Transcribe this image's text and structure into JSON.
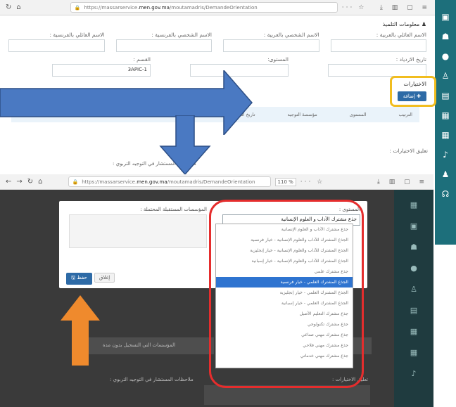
{
  "browser_top": {
    "url_prefix": "https://massarservice.",
    "url_domain": "men.gov.ma",
    "url_path": "/moutamadris/DemandeOrientation"
  },
  "form": {
    "section_title": "معلومات التلميذ",
    "fields": {
      "lastname_ar": "الاسم العائلي بالعربية :",
      "firstname_ar": "الاسم الشخصي بالعربية :",
      "firstname_fr": "الاسم الشخصي بالفرنسية :",
      "lastname_fr": "الاسم العائلي بالفرنسية :",
      "birth_date": "تاريخ الازدياد :",
      "level": "المستوى:",
      "class": "القسم :",
      "class_value": "3APIC-1"
    },
    "choices_title": "الاختيارات",
    "add_button": "إضافة",
    "table_headers": [
      "الترتيب",
      "المستوى",
      "مؤسسة التوجيه",
      "تاريخ التسجيل بدون مدة"
    ],
    "comments_label": "تعليق الاختيارات :",
    "counselor_label": "ملاحظات المستشار في التوجيه التربوي :"
  },
  "browser_bottom": {
    "url_prefix": "https://massarservice.",
    "url_domain": "men.gov.ma",
    "url_path": "/moutamadris/DemandeOrientation",
    "zoom": "110 %"
  },
  "modal": {
    "choice_label": "المستوى :",
    "choice_value": "جذع مشترك الآداب و العلوم الإنسانية",
    "institutions_label": "المؤسسات المستقبلة المحتملة :",
    "save_button": "حفظ",
    "close_button": "إغلاق"
  },
  "dropdown_options": [
    "جذع مشترك الآداب و العلوم الإنسانية",
    "الجذع المشترك للآداب والعلوم الإنسانية - خيار فرنسية",
    "الجذع المشترك للآداب والعلوم الإنسانية - خيار إنجليزية",
    "الجذع المشترك للآداب والعلوم الإنسانية - خيار إسبانية",
    "جذع مشترك علمي",
    "الجذع المشترك العلمي - خيار فرنسية",
    "الجذع المشترك العلمي - خيار إنجليزية",
    "الجذع المشترك العلمي - خيار إسبانية",
    "جذع مشترك التعليم الأصيل",
    "جذع مشترك تكنولوجي",
    "جذع مشترك مهني صناعي",
    "جذع مشترك مهني فلاحي",
    "جذع مشترك مهني خدماتي"
  ],
  "dropdown_selected_index": 5,
  "bottom": {
    "left_strip": "المؤسسات التي التسجيل بدون مدة",
    "counselor_label": "ملاحظات المستشار في التوجيه التربوي :",
    "comments_label": "تعليق الاختيارات :"
  },
  "colors": {
    "sidebar": "#1d6f7b",
    "arrow_blue": "#4a79c2",
    "arrow_orange": "#ef8a2d",
    "highlight_yellow": "#f1bd1f",
    "highlight_red": "#e52d2d",
    "selected": "#2f74d0"
  }
}
